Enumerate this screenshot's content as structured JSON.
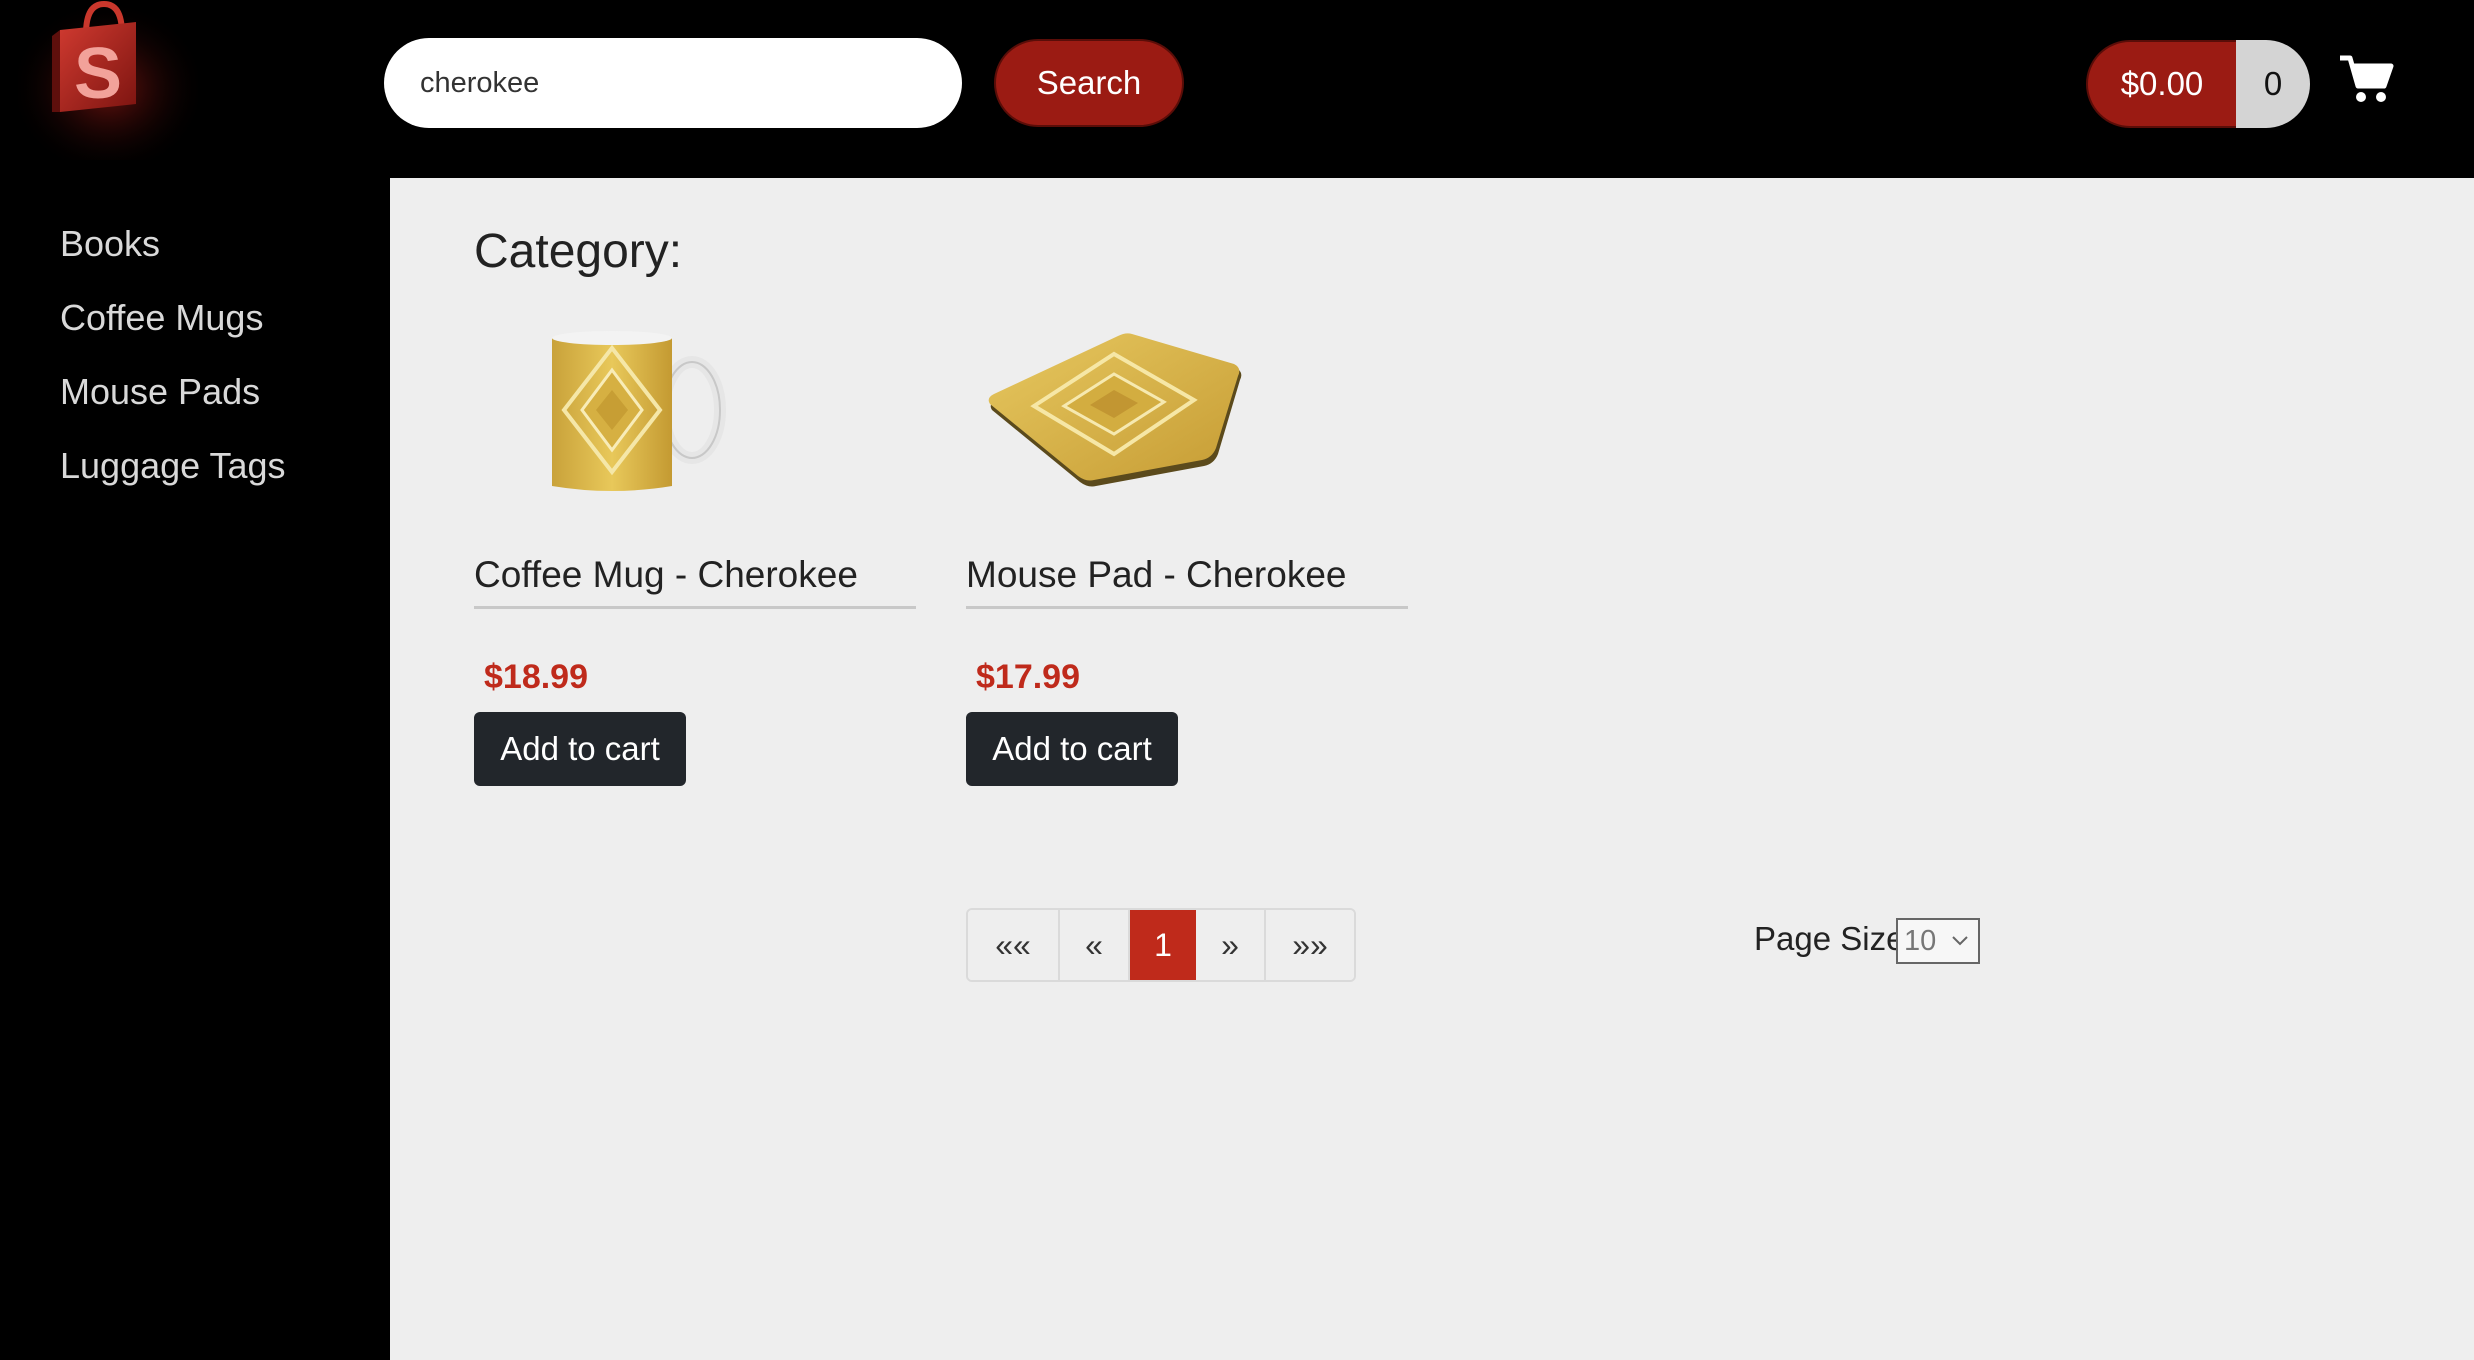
{
  "header": {
    "search": {
      "value": "cherokee"
    },
    "search_button": "Search",
    "cart_total": "$0.00",
    "cart_count": "0"
  },
  "sidebar": {
    "items": [
      {
        "label": "Books"
      },
      {
        "label": "Coffee Mugs"
      },
      {
        "label": "Mouse Pads"
      },
      {
        "label": "Luggage Tags"
      }
    ]
  },
  "main": {
    "category_title": "Category:",
    "products": [
      {
        "name": "Coffee Mug - Cherokee",
        "price": "$18.99",
        "button": "Add to cart",
        "image": "mug-image"
      },
      {
        "name": "Mouse Pad - Cherokee",
        "price": "$17.99",
        "button": "Add to cart",
        "image": "mousepad-image"
      }
    ],
    "pagination": {
      "first": "««",
      "prev": "«",
      "current": "1",
      "next": "»",
      "last": "»»"
    },
    "page_size": {
      "label": "Page Size",
      "value": "10"
    }
  },
  "colors": {
    "brand_red": "#9b1b13",
    "price_red": "#bf2a1b",
    "button_dark": "#22262b",
    "background": "#eeeeee"
  }
}
